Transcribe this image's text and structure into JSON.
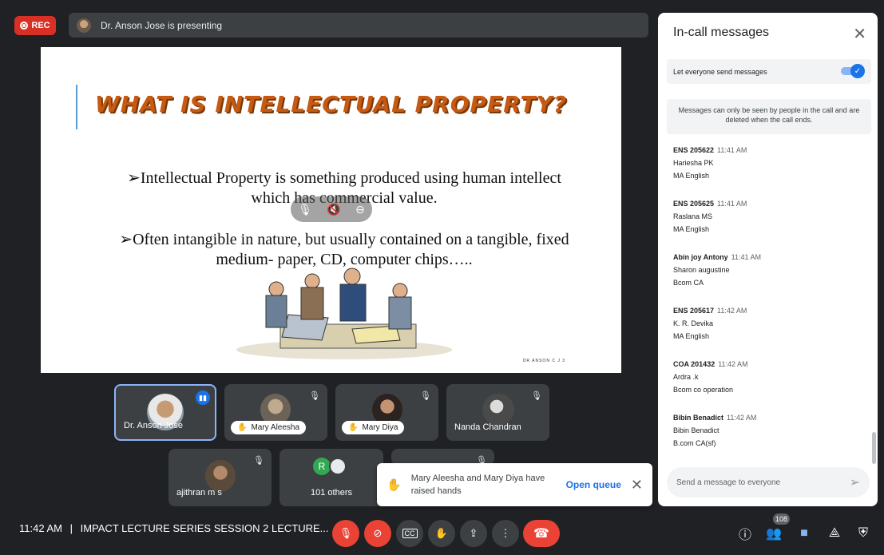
{
  "top": {
    "rec_label": "REC",
    "presenting_text": "Dr. Anson Jose is presenting"
  },
  "slide": {
    "title": "WHAT IS INTELLECTUAL PROPERTY?",
    "bullet1_line1": "➢Intellectual Property is something produced using human intellect",
    "bullet1_line2": "which has commercial value.",
    "bullet2_line1": "➢Often intangible in nature, but usually contained on a tangible, fixed",
    "bullet2_line2": "medium- paper, CD, computer chips…..",
    "footer": "DR ANSON C J 3"
  },
  "participants": [
    {
      "name": "Dr. Anson Jose"
    },
    {
      "name": "Mary Aleesha"
    },
    {
      "name": "Mary Diya"
    },
    {
      "name": "Nanda Chandran"
    },
    {
      "name": "ajithran m s"
    },
    {
      "name": "101 others",
      "avatar_letter": "R"
    }
  ],
  "notice": {
    "text": "Mary Aleesha and Mary Diya have raised hands",
    "action": "Open queue"
  },
  "bottom": {
    "time": "11:42 AM",
    "separator": "|",
    "meeting_title": "IMPACT LECTURE SERIES SESSION 2 LECTURE...",
    "people_count": "108"
  },
  "panel": {
    "title": "In-call messages",
    "toggle_label": "Let everyone send messages",
    "info": "Messages can only be seen by people in the call and are deleted when the call ends.",
    "messages": [
      {
        "sender": "ENS 205622",
        "time": "11:41 AM",
        "line1": "Hariesha PK",
        "line2": "MA English"
      },
      {
        "sender": "ENS 205625",
        "time": "11:41 AM",
        "line1": "Raslana MS",
        "line2": "MA English"
      },
      {
        "sender": "Abin joy Antony",
        "time": "11:41 AM",
        "line1": "Sharon augustine",
        "line2": "Bcom CA"
      },
      {
        "sender": "ENS 205617",
        "time": "11:42 AM",
        "line1": "K. R. Devika",
        "line2": "MA English"
      },
      {
        "sender": "COA 201432",
        "time": "11:42 AM",
        "line1": "Ardra .k",
        "line2": "Bcom co operation"
      },
      {
        "sender": "Bibin Benadict",
        "time": "11:42 AM",
        "line1": "Bibin Benadict",
        "line2": "B.com CA(sf)"
      }
    ],
    "input_placeholder": "Send a message to everyone"
  },
  "colors": {
    "accent": "#1a73e8",
    "danger": "#ea4335",
    "background": "#202124",
    "tile": "#3c4043"
  }
}
